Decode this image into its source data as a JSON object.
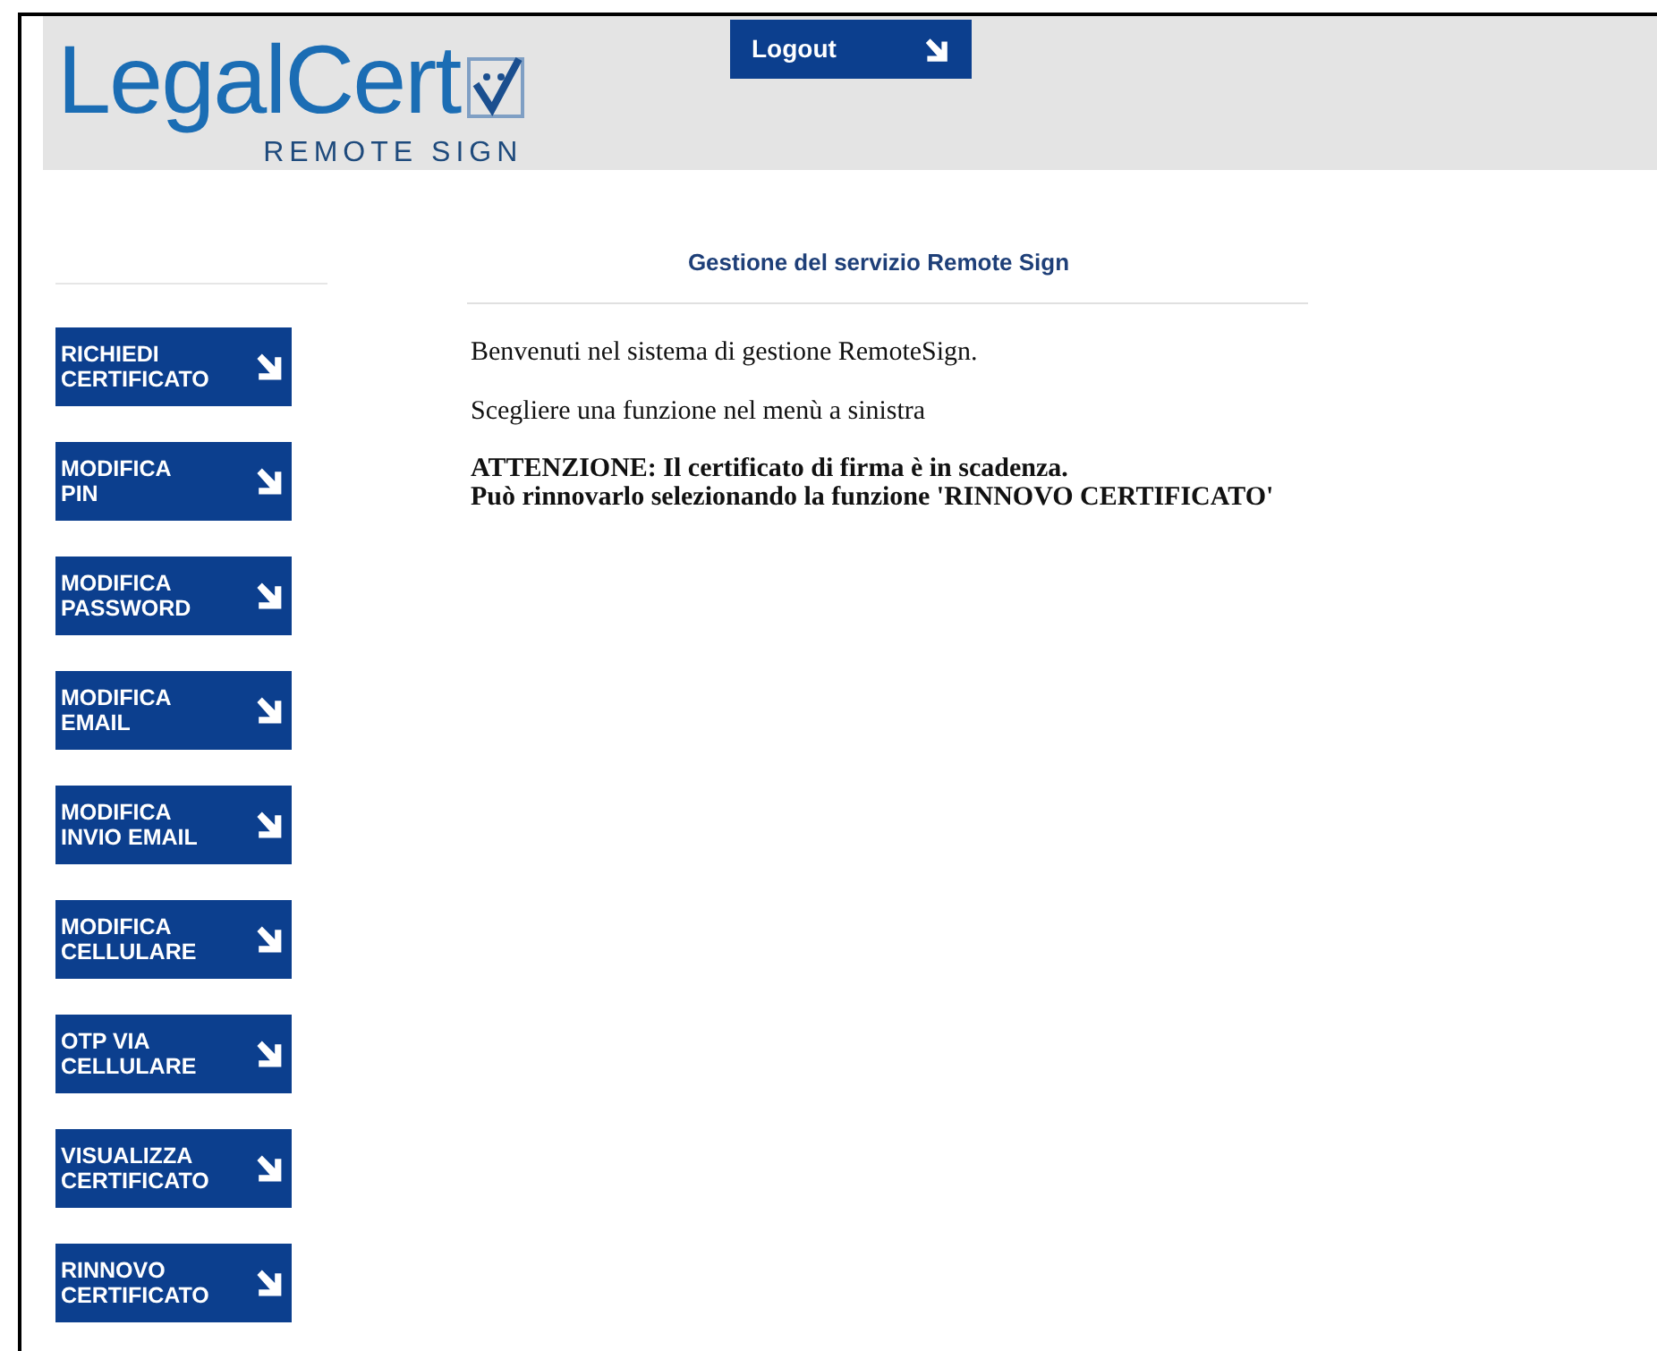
{
  "logo": {
    "name": "LegalCert",
    "subtitle": "REMOTE SIGN"
  },
  "logout": {
    "label": "Logout"
  },
  "sidebar": {
    "items": [
      {
        "lines": [
          "RICHIEDI",
          "CERTIFICATO"
        ]
      },
      {
        "lines": [
          "MODIFICA",
          "PIN"
        ]
      },
      {
        "lines": [
          "MODIFICA",
          "PASSWORD"
        ]
      },
      {
        "lines": [
          "MODIFICA",
          "EMAIL"
        ]
      },
      {
        "lines": [
          "MODIFICA",
          "INVIO EMAIL"
        ]
      },
      {
        "lines": [
          "MODIFICA",
          "CELLULARE"
        ]
      },
      {
        "lines": [
          "OTP VIA",
          "CELLULARE"
        ]
      },
      {
        "lines": [
          "VISUALIZZA",
          "CERTIFICATO"
        ]
      },
      {
        "lines": [
          "RINNOVO",
          "CERTIFICATO"
        ]
      }
    ]
  },
  "main": {
    "title": "Gestione del servizio Remote Sign",
    "paragraphs": [
      "Benvenuti nel sistema di gestione RemoteSign.",
      "Scegliere una funzione nel menù a sinistra"
    ],
    "warning": [
      "ATTENZIONE: Il certificato di firma è in scadenza.",
      "Può rinnovarlo selezionando la funzione 'RINNOVO CERTIFICATO'"
    ]
  }
}
